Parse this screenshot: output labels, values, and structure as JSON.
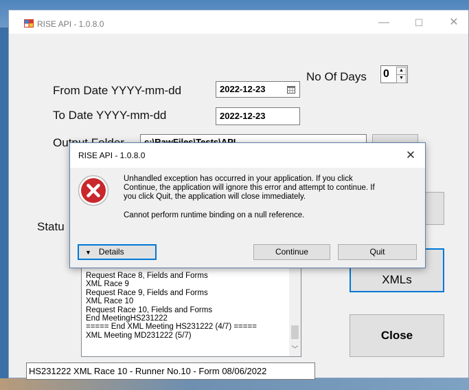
{
  "window": {
    "title": "RISE API - 1.0.8.0",
    "controls": {
      "minimize": "—",
      "maximize": "☐",
      "close": "✕"
    }
  },
  "form": {
    "no_of_days_label": "No Of Days",
    "no_of_days_value": "0",
    "from_date_label": "From Date YYYY-mm-dd",
    "from_date_value": "2022-12-23",
    "to_date_label": "To Date YYYY-mm-dd",
    "to_date_value": "2022-12-23",
    "output_folder_label": "Output Folder",
    "output_folder_value": "c:\\RawFiles\\Tests\\API",
    "status_label": "Statu",
    "xmls_button": "XMLs",
    "close_button": "Close"
  },
  "log": {
    "lines": [
      "Request Race 8, Fields and Forms",
      "XML Race 9",
      "Request Race 9, Fields and Forms",
      "XML Race 10",
      "Request Race 10, Fields and Forms",
      "End MeetingHS231222",
      "===== End XML Meeting HS231222 (4/7) =====",
      "XML Meeting MD231222 (5/7)"
    ]
  },
  "status_bar": "HS231222 XML Race 10 - Runner No.10 - Form 08/06/2022",
  "dialog": {
    "title": "RISE API - 1.0.8.0",
    "close": "✕",
    "message_line1": "Unhandled exception has occurred in your application. If you click",
    "message_line2": "Continue, the application will ignore this error and attempt to continue. If",
    "message_line3": "you click Quit, the application will close immediately.",
    "message_detail": "Cannot perform runtime binding on a null reference.",
    "details_button": "Details",
    "continue_button": "Continue",
    "quit_button": "Quit"
  },
  "icons": {
    "error": "error-x-circle",
    "calendar": "calendar-icon",
    "app": "app-icon"
  },
  "colors": {
    "error_red": "#c8272d",
    "desktop_blue": "#3c6fa5",
    "focus_blue": "#0078d7"
  }
}
